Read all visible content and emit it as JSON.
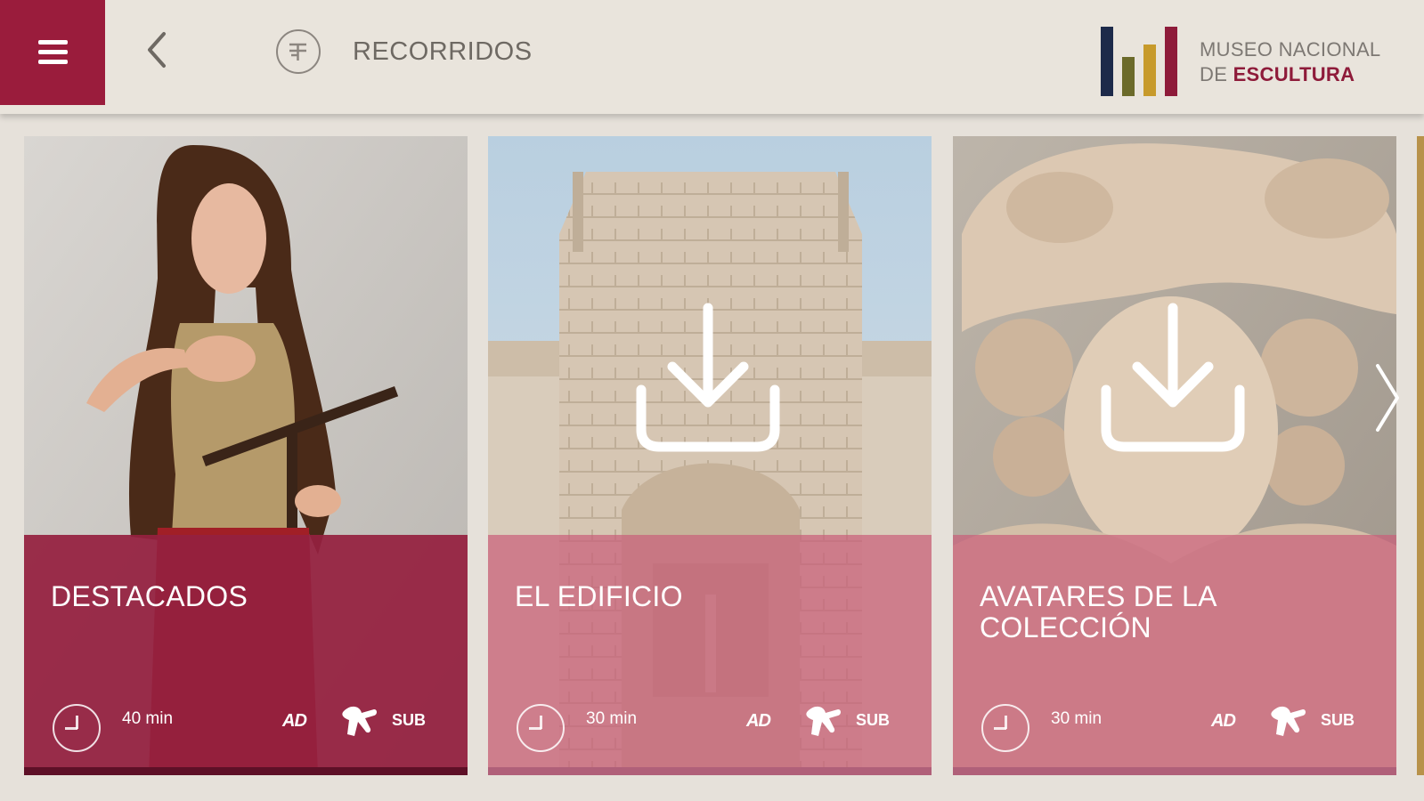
{
  "header": {
    "menu_icon": "hamburger-icon",
    "back_icon": "chevron-left-icon",
    "section_icon": "tours-icon",
    "section_title": "RECORRIDOS",
    "logo": {
      "line1": "MUSEO NACIONAL",
      "line2_prefix": "DE ",
      "line2_bold": "ESCULTURA",
      "bar_colors": [
        "#1d2a4a",
        "#6b6a2a",
        "#c79a2b",
        "#8e1b3a"
      ]
    }
  },
  "colors": {
    "brand": "#9a1c3c",
    "panel_active": "#94203f",
    "panel_inactive": "#c9607a"
  },
  "cards": [
    {
      "title": "DESTACADOS",
      "duration": "40 min",
      "downloaded": true,
      "accessibility": {
        "audio_description": "AD",
        "sign_language": "sign-language-icon",
        "subtitles": "SUB"
      }
    },
    {
      "title": "EL EDIFICIO",
      "duration": "30 min",
      "downloaded": false,
      "download_icon": "download-icon",
      "accessibility": {
        "audio_description": "AD",
        "sign_language": "sign-language-icon",
        "subtitles": "SUB"
      }
    },
    {
      "title": "AVATARES DE LA COLECCIÓN",
      "duration": "30 min",
      "downloaded": false,
      "download_icon": "download-icon",
      "accessibility": {
        "audio_description": "AD",
        "sign_language": "sign-language-icon",
        "subtitles": "SUB"
      }
    }
  ],
  "carousel": {
    "next_icon": "chevron-right-icon"
  }
}
